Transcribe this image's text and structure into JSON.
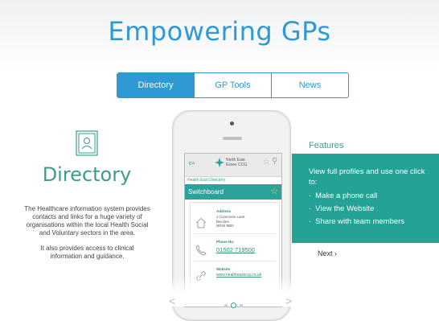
{
  "header": {
    "title": "Empowering GPs"
  },
  "tabs": [
    {
      "label": "Directory",
      "active": true
    },
    {
      "label": "GP Tools",
      "active": false
    },
    {
      "label": "News",
      "active": false
    }
  ],
  "section": {
    "title": "Directory",
    "paragraphs": [
      "The Healthcare information system provides contacts and links for a huge variety of organisations within the local Health Social and Voluntary sectors in the area.",
      "It also provides access to clinical information and guidance."
    ]
  },
  "phone_app": {
    "org_line1": "North East",
    "org_line2": "Essex CCG",
    "breadcrumb": "Health East Directory",
    "bar_title": "Switchboard",
    "address_label": "Address",
    "address_lines": [
      "1 Commons Lane",
      "Beccles",
      "NR34 9BN"
    ],
    "phone_label": "Phone No.",
    "phone_number": "01502 719500",
    "website_label": "Website",
    "website_url": "www.healtheastccg.co.uk"
  },
  "features": {
    "title": "Features",
    "intro": "View full profiles and use one click to:",
    "items": [
      "Make a phone call",
      "View the Website",
      "Share with team members"
    ],
    "next_label": "Next ›"
  },
  "carousel": {
    "prev": "<",
    "next": ">"
  },
  "colors": {
    "accent_blue": "#2d9ad4",
    "teal": "#26a195"
  }
}
